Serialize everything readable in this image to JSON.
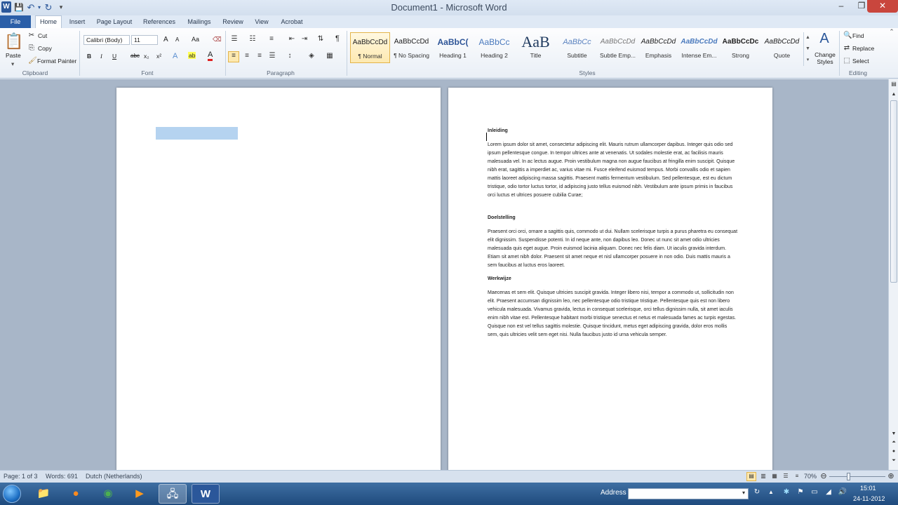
{
  "window": {
    "title": "Document1  -  Microsoft Word",
    "minimize": "–",
    "maximize": "❐",
    "close": "✕"
  },
  "qat": {
    "logo": "W",
    "save": "💾",
    "undo": "↶",
    "redo": "↻",
    "more": "▾"
  },
  "tabs": [
    "File",
    "Home",
    "Insert",
    "Page Layout",
    "References",
    "Mailings",
    "Review",
    "View",
    "Acrobat"
  ],
  "clipboard": {
    "paste": "Paste",
    "cut": "Cut",
    "copy": "Copy",
    "format_painter": "Format Painter",
    "label": "Clipboard"
  },
  "font": {
    "name": "Calibri (Body)",
    "size": "11",
    "label": "Font",
    "bold": "B",
    "italic": "I",
    "underline": "U",
    "strike": "abc",
    "sub": "x₂",
    "sup": "x²",
    "grow": "A",
    "shrink": "A",
    "case": "Aa",
    "clear": "⌫",
    "effects": "A",
    "highlight": "ab",
    "color": "A"
  },
  "paragraph": {
    "label": "Paragraph"
  },
  "styles": {
    "label": "Styles",
    "items": [
      {
        "preview": "AaBbCcDd",
        "name": "¶ Normal"
      },
      {
        "preview": "AaBbCcDd",
        "name": "¶ No Spacing"
      },
      {
        "preview": "AaBbC(",
        "name": "Heading 1"
      },
      {
        "preview": "AaBbCc",
        "name": "Heading 2"
      },
      {
        "preview": "AaB",
        "name": "Title"
      },
      {
        "preview": "AaBbCc",
        "name": "Subtitle"
      },
      {
        "preview": "AaBbCcDd",
        "name": "Subtle Emp..."
      },
      {
        "preview": "AaBbCcDd",
        "name": "Emphasis"
      },
      {
        "preview": "AaBbCcDd",
        "name": "Intense Em..."
      },
      {
        "preview": "AaBbCcDc",
        "name": "Strong"
      },
      {
        "preview": "AaBbCcDd",
        "name": "Quote"
      }
    ],
    "change_styles": "Change Styles"
  },
  "editing": {
    "find": "Find",
    "replace": "Replace",
    "select": "Select",
    "label": "Editing"
  },
  "document": {
    "sections": [
      {
        "heading": "Inleiding",
        "body": "Lorem ipsum dolor sit amet, consectetur adipiscing elit. Mauris rutrum ullamcorper dapibus. Integer quis odio sed ipsum pellentesque congue. In tempor ultrices ante at venenatis. Ut sodales molestie erat, ac facilisis mauris malesuada vel. In ac lectus augue. Proin vestibulum magna non augue faucibus at fringilla enim suscipit. Quisque nibh erat, sagittis a imperdiet ac, varius vitae mi. Fusce eleifend euismod tempus. Morbi convallis odio et sapien mattis laoreet adipiscing massa sagittis. Praesent mattis fermentum vestibulum. Sed pellentesque, est eu dictum tristique, odio tortor luctus tortor, id adipiscing justo tellus euismod nibh. Vestibulum ante ipsum primis in faucibus orci luctus et ultrices posuere cubilia Curae;"
      },
      {
        "heading": "Doelstelling",
        "body": "Praesent orci orci, ornare a sagittis quis, commodo ut dui. Nullam scelerisque turpis a purus pharetra eu consequat elit dignissim. Suspendisse potenti. In id neque ante, non dapibus leo. Donec ut nunc sit amet odio ultricies malesuada quis eget augue. Proin euismod lacinia aliquam. Donec nec felis diam. Ut iaculis gravida interdum. Etiam sit amet nibh dolor. Praesent sit amet neque et nisl ullamcorper posuere in non odio. Duis mattis mauris a sem faucibus at luctus eros laoreet."
      },
      {
        "heading": "Werkwijze",
        "body": "Maecenas et sem elit. Quisque ultricies suscipit gravida. Integer libero nisi, tempor a commodo ut, sollicitudin non elit. Praesent accumsan dignissim leo, nec pellentesque odio tristique tristique. Pellentesque quis est non libero vehicula malesuada. Vivamus gravida, lectus in consequat scelerisque, orci tellus dignissim nulla, sit amet iaculis enim nibh vitae est. Pellentesque habitant morbi tristique senectus et netus et malesuada fames ac turpis egestas. Quisque non est vel tellus sagittis molestie. Quisque tincidunt, metus eget adipiscing gravida, dolor eros mollis sem, quis ultricies velit sem eget nisi. Nulla faucibus justo id urna vehicula semper."
      }
    ]
  },
  "status": {
    "page": "Page: 1 of 3",
    "words": "Words: 691",
    "language": "Dutch (Netherlands)",
    "zoom": "70%"
  },
  "taskbar": {
    "address_label": "Address",
    "time": "15:01",
    "date": "24-11-2012"
  }
}
